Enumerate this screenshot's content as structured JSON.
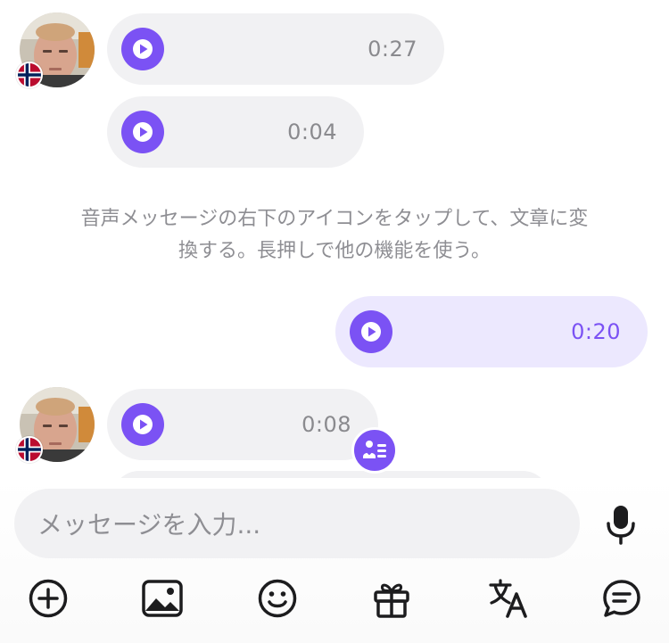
{
  "theme": {
    "accent": "#7b52f4",
    "bubble_incoming": "#f1f1f3",
    "bubble_outgoing": "#ece8fe",
    "muted_text": "#8e8e93"
  },
  "messages": [
    {
      "sender": "other",
      "type": "voice",
      "duration": "0:27",
      "show_avatar": true
    },
    {
      "sender": "other",
      "type": "voice",
      "duration": "0:04",
      "show_avatar": false
    },
    {
      "sender": "mine",
      "type": "voice",
      "duration": "0:20",
      "show_avatar": false
    },
    {
      "sender": "other",
      "type": "voice",
      "duration": "0:08",
      "show_avatar": true
    }
  ],
  "system_note": {
    "line1": "音声メッセージの右下のアイコンをタップして、文章に変",
    "line2": "換する。長押しで他の機能を使う。"
  },
  "composer": {
    "placeholder": "メッセージを入力...",
    "mic_icon": "microphone-icon"
  },
  "toolbar": {
    "icons": [
      "plus-circle-icon",
      "image-icon",
      "smiley-icon",
      "gift-icon",
      "translate-icon",
      "chat-bubble-icon"
    ]
  }
}
